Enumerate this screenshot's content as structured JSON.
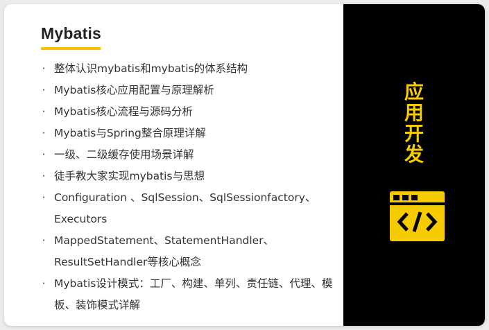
{
  "card": {
    "title": "Mybatis",
    "items": [
      "整体认识mybatis和mybatis的体系结构",
      "Mybatis核心应用配置与原理解析",
      "Mybatis核心流程与源码分析",
      "Mybatis与Spring整合原理详解",
      "一级、二级缓存使用场景详解",
      "徒手教大家实现mybatis与思想",
      "Configuration 、SqlSession、SqlSessionfactory、Executors",
      "MappedStatement、StatementHandler、ResultSetHandler等核心概念",
      "Mybatis设计模式：工厂、构建、单列、责任链、代理、模板、装饰模式详解"
    ],
    "bullet": "·"
  },
  "side": {
    "chars": [
      "应",
      "用",
      "开",
      "发"
    ],
    "icon": "code-window-icon"
  },
  "colors": {
    "accent": "#f6cc00",
    "side_background": "#000000",
    "text": "#333333"
  }
}
